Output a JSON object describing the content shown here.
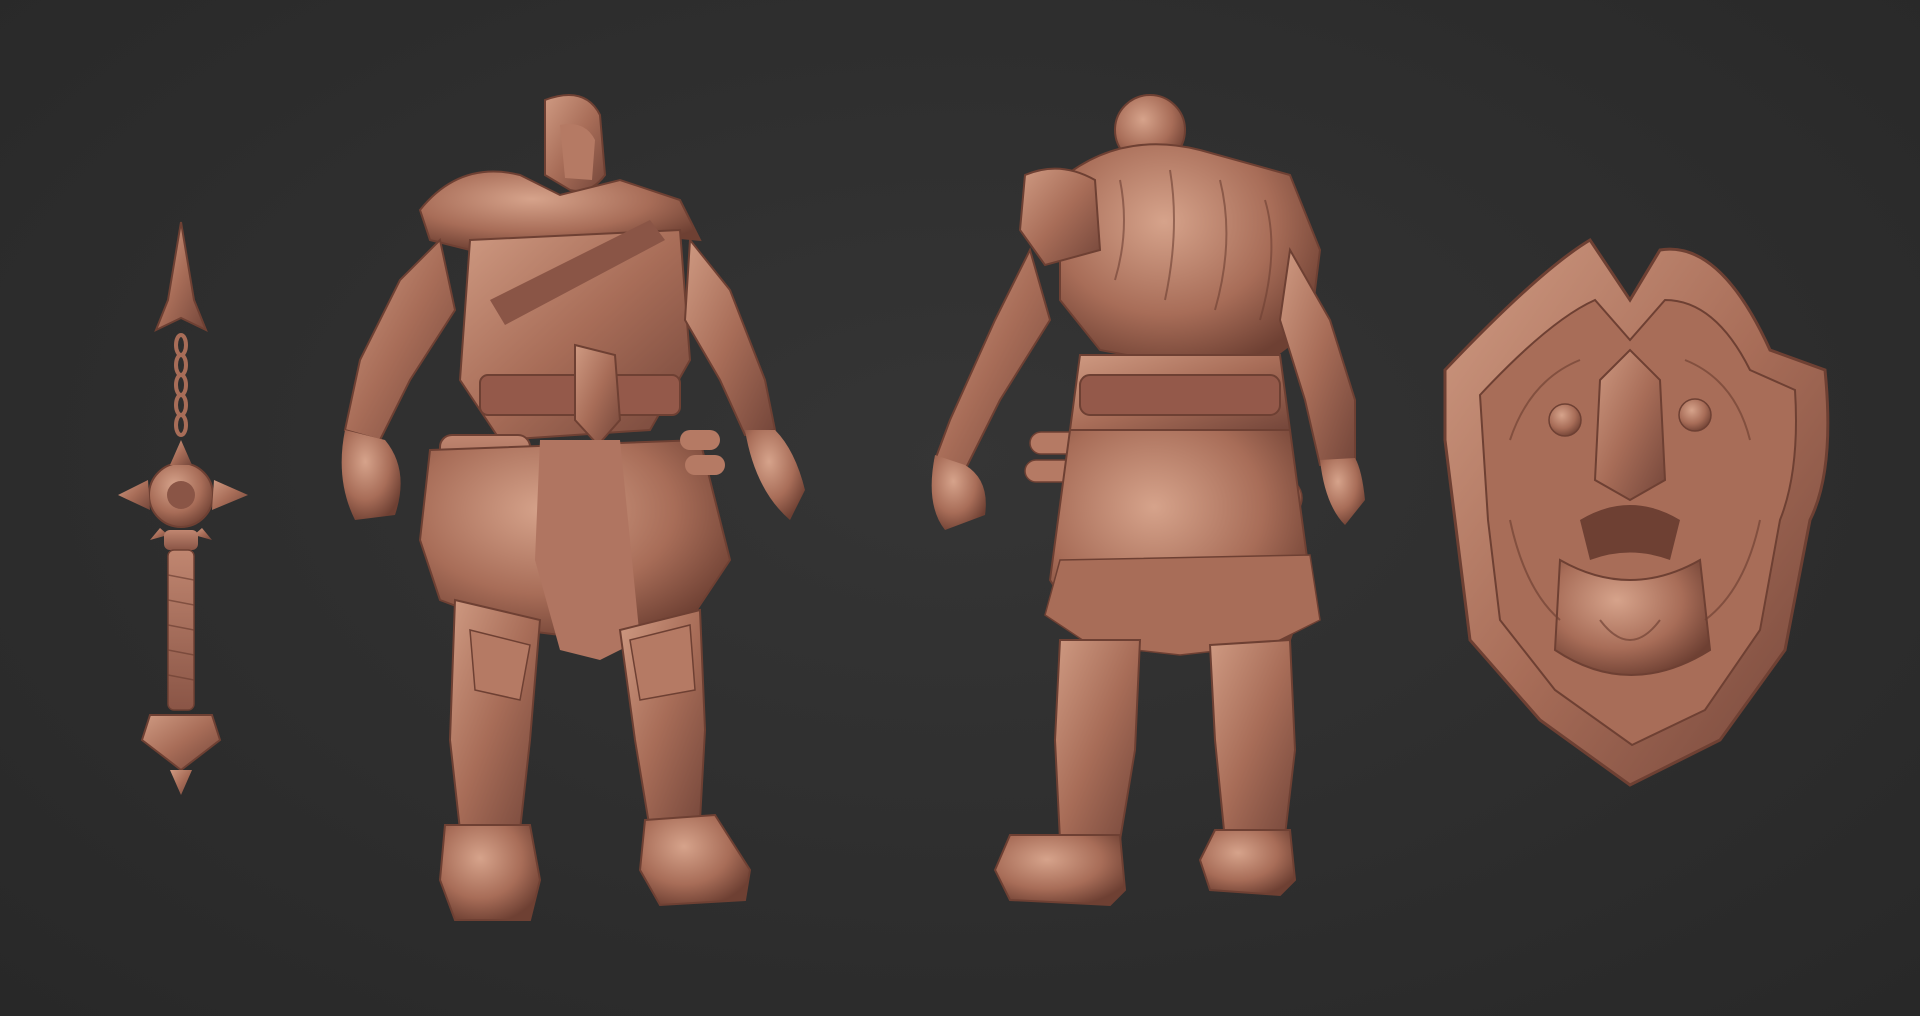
{
  "scene": {
    "background_color": "#2d2d2d",
    "clay_color": "#a86d58",
    "clay_shadow": "#6e4033",
    "clay_highlight": "#cf9a82",
    "objects": [
      {
        "id": "flail",
        "kind": "weapon-flail-mace"
      },
      {
        "id": "warrior-front",
        "kind": "armored-warrior-front-view"
      },
      {
        "id": "warrior-back",
        "kind": "armored-warrior-back-view"
      },
      {
        "id": "shield",
        "kind": "lion-face-shield"
      }
    ]
  }
}
